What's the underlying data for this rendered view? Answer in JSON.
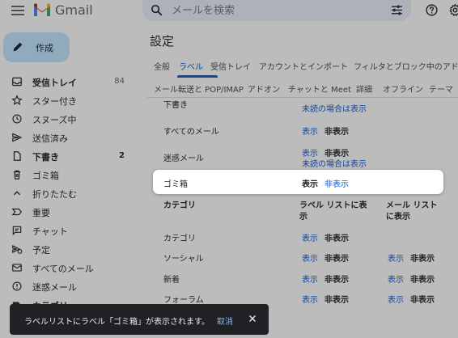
{
  "app": {
    "name": "Gmail"
  },
  "search": {
    "placeholder": "メールを検索"
  },
  "compose": {
    "label": "作成"
  },
  "sidebar": {
    "items": [
      {
        "label": "受信トレイ",
        "count": "84",
        "bold": true
      },
      {
        "label": "スター付き",
        "count": ""
      },
      {
        "label": "スヌーズ中",
        "count": ""
      },
      {
        "label": "送信済み",
        "count": ""
      },
      {
        "label": "下書き",
        "count": "2",
        "bold": true
      },
      {
        "label": "ゴミ箱",
        "count": ""
      },
      {
        "label": "折りたたむ",
        "count": ""
      },
      {
        "label": "重要",
        "count": ""
      },
      {
        "label": "チャット",
        "count": ""
      },
      {
        "label": "予定",
        "count": ""
      },
      {
        "label": "すべてのメール",
        "count": ""
      },
      {
        "label": "迷惑メール",
        "count": ""
      },
      {
        "label": "カテゴリ",
        "count": "",
        "bold": true
      }
    ]
  },
  "settings": {
    "title": "設定",
    "tabs_row1": [
      "全般",
      "ラベル",
      "受信トレイ",
      "アカウントとインポート",
      "フィルタとブロック中のアド"
    ],
    "tabs_row2": [
      "メール転送と POP/IMAP",
      "アドオン",
      "チャットと Meet",
      "詳細",
      "オフライン",
      "テーマ"
    ],
    "active_tab": "ラベル",
    "partial_row": {
      "label": "下書き",
      "sub": "未読の場合は表示"
    },
    "rows": [
      {
        "label": "すべてのメール",
        "show": "表示",
        "hide": "非表示"
      },
      {
        "label": "迷惑メール",
        "show": "表示",
        "hide": "非表示",
        "sub": "未読の場合は表示"
      }
    ],
    "highlight_row": {
      "label": "ゴミ箱",
      "show": "表示",
      "hide": "非表示"
    },
    "category_header": {
      "label": "カテゴリ",
      "col1_line1": "ラベル リストに表",
      "col1_line2": "示",
      "col2_line1": "メール リスト",
      "col2_line2": "に表示"
    },
    "category_rows": [
      {
        "label": "カテゴリ",
        "show": "表示",
        "hide": "非表示"
      },
      {
        "label": "ソーシャル",
        "show": "表示",
        "hide": "非表示",
        "show2": "表示",
        "hide2": "非表示"
      },
      {
        "label": "新着",
        "show": "表示",
        "hide": "非表示",
        "show2": "表示",
        "hide2": "非表示"
      },
      {
        "label": "フォーラム",
        "show": "表示",
        "hide": "非表示",
        "show2": "表示",
        "hide2": "非表示"
      }
    ]
  },
  "snackbar": {
    "message": "ラベルリストにラベル「ゴミ箱」が表示されます。",
    "undo": "取消"
  },
  "colors": {
    "accent": "#0b57d0",
    "compose_bg": "#c2e7ff",
    "snackbar_bg": "#202124"
  }
}
